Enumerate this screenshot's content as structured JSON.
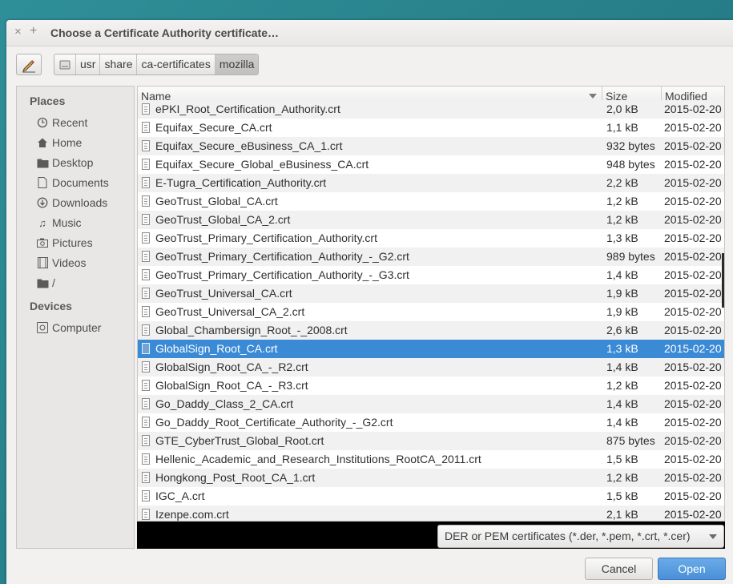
{
  "window": {
    "title": "Choose a Certificate Authority certificate…",
    "close_glyph": "×",
    "max_glyph": "+"
  },
  "pathbar": {
    "crumbs": [
      "usr",
      "share",
      "ca-certificates",
      "mozilla"
    ]
  },
  "sidebar": {
    "places_header": "Places",
    "places": [
      {
        "label": "Recent",
        "icon": "clock-icon"
      },
      {
        "label": "Home",
        "icon": "home-icon"
      },
      {
        "label": "Desktop",
        "icon": "folder-icon"
      },
      {
        "label": "Documents",
        "icon": "document-icon"
      },
      {
        "label": "Downloads",
        "icon": "download-icon"
      },
      {
        "label": "Music",
        "icon": "music-icon"
      },
      {
        "label": "Pictures",
        "icon": "camera-icon"
      },
      {
        "label": "Videos",
        "icon": "film-icon"
      },
      {
        "label": "/",
        "icon": "folder-icon"
      }
    ],
    "devices_header": "Devices",
    "devices": [
      {
        "label": "Computer",
        "icon": "drive-icon"
      }
    ]
  },
  "columns": {
    "name": "Name",
    "size": "Size",
    "modified": "Modified"
  },
  "files": [
    {
      "name": "ePKI_Root_Certification_Authority.crt",
      "size": "2,0 kB",
      "date": "2015-02-20"
    },
    {
      "name": "Equifax_Secure_CA.crt",
      "size": "1,1 kB",
      "date": "2015-02-20"
    },
    {
      "name": "Equifax_Secure_eBusiness_CA_1.crt",
      "size": "932 bytes",
      "date": "2015-02-20"
    },
    {
      "name": "Equifax_Secure_Global_eBusiness_CA.crt",
      "size": "948 bytes",
      "date": "2015-02-20"
    },
    {
      "name": "E-Tugra_Certification_Authority.crt",
      "size": "2,2 kB",
      "date": "2015-02-20"
    },
    {
      "name": "GeoTrust_Global_CA.crt",
      "size": "1,2 kB",
      "date": "2015-02-20"
    },
    {
      "name": "GeoTrust_Global_CA_2.crt",
      "size": "1,2 kB",
      "date": "2015-02-20"
    },
    {
      "name": "GeoTrust_Primary_Certification_Authority.crt",
      "size": "1,3 kB",
      "date": "2015-02-20"
    },
    {
      "name": "GeoTrust_Primary_Certification_Authority_-_G2.crt",
      "size": "989 bytes",
      "date": "2015-02-20"
    },
    {
      "name": "GeoTrust_Primary_Certification_Authority_-_G3.crt",
      "size": "1,4 kB",
      "date": "2015-02-20"
    },
    {
      "name": "GeoTrust_Universal_CA.crt",
      "size": "1,9 kB",
      "date": "2015-02-20"
    },
    {
      "name": "GeoTrust_Universal_CA_2.crt",
      "size": "1,9 kB",
      "date": "2015-02-20"
    },
    {
      "name": "Global_Chambersign_Root_-_2008.crt",
      "size": "2,6 kB",
      "date": "2015-02-20"
    },
    {
      "name": "GlobalSign_Root_CA.crt",
      "size": "1,3 kB",
      "date": "2015-02-20",
      "selected": true
    },
    {
      "name": "GlobalSign_Root_CA_-_R2.crt",
      "size": "1,4 kB",
      "date": "2015-02-20"
    },
    {
      "name": "GlobalSign_Root_CA_-_R3.crt",
      "size": "1,2 kB",
      "date": "2015-02-20"
    },
    {
      "name": "Go_Daddy_Class_2_CA.crt",
      "size": "1,4 kB",
      "date": "2015-02-20"
    },
    {
      "name": "Go_Daddy_Root_Certificate_Authority_-_G2.crt",
      "size": "1,4 kB",
      "date": "2015-02-20"
    },
    {
      "name": "GTE_CyberTrust_Global_Root.crt",
      "size": "875 bytes",
      "date": "2015-02-20"
    },
    {
      "name": "Hellenic_Academic_and_Research_Institutions_RootCA_2011.crt",
      "size": "1,5 kB",
      "date": "2015-02-20"
    },
    {
      "name": "Hongkong_Post_Root_CA_1.crt",
      "size": "1,2 kB",
      "date": "2015-02-20"
    },
    {
      "name": "IGC_A.crt",
      "size": "1,5 kB",
      "date": "2015-02-20"
    },
    {
      "name": "Izenpe.com.crt",
      "size": "2,1 kB",
      "date": "2015-02-20"
    }
  ],
  "filter": {
    "label": "DER or PEM certificates (*.der, *.pem, *.crt, *.cer)"
  },
  "buttons": {
    "cancel": "Cancel",
    "open": "Open"
  },
  "colors": {
    "selection": "#3b8ad6",
    "open_button": "#4a90d8",
    "desktop_bg": "#2f8f98"
  }
}
